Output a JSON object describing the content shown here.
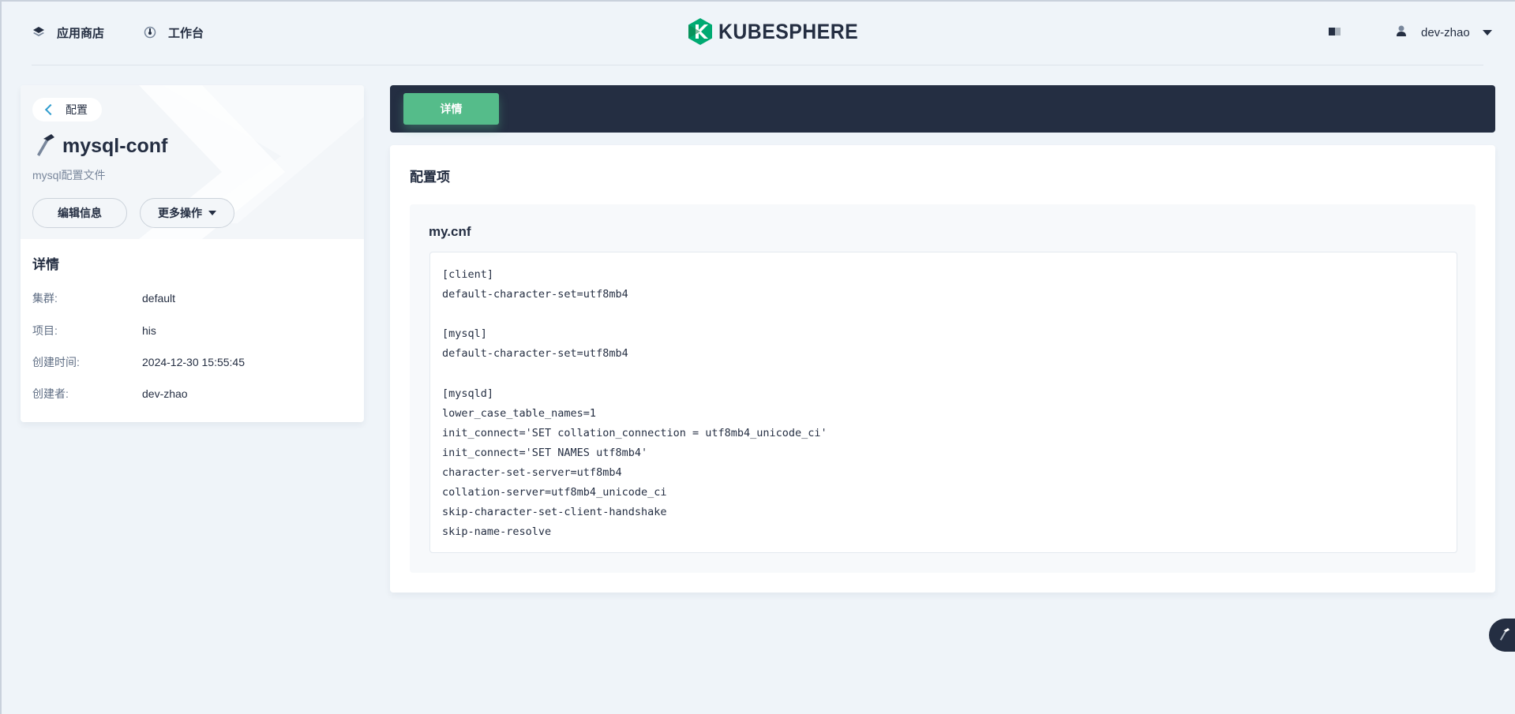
{
  "header": {
    "nav": [
      {
        "label": "应用商店",
        "icon": "layers-icon"
      },
      {
        "label": "工作台",
        "icon": "dashboard-icon"
      }
    ],
    "logo_text": "KUBESPHERE",
    "user": {
      "name": "dev-zhao"
    }
  },
  "resource": {
    "back_label": "配置",
    "name": "mysql-conf",
    "description": "mysql配置文件",
    "buttons": {
      "edit": "编辑信息",
      "more": "更多操作"
    }
  },
  "details": {
    "title": "详情",
    "rows": [
      {
        "key": "集群:",
        "value": "default"
      },
      {
        "key": "项目:",
        "value": "his"
      },
      {
        "key": "创建时间:",
        "value": "2024-12-30 15:55:45"
      },
      {
        "key": "创建者:",
        "value": "dev-zhao"
      }
    ]
  },
  "tabs": [
    {
      "label": "详情",
      "active": true
    }
  ],
  "config": {
    "section_title": "配置项",
    "items": [
      {
        "key": "my.cnf",
        "value": "[client]\ndefault-character-set=utf8mb4\n\n[mysql]\ndefault-character-set=utf8mb4\n\n[mysqld]\nlower_case_table_names=1\ninit_connect='SET collation_connection = utf8mb4_unicode_ci'\ninit_connect='SET NAMES utf8mb4'\ncharacter-set-server=utf8mb4\ncollation-server=utf8mb4_unicode_ci\nskip-character-set-client-handshake\nskip-name-resolve"
      }
    ]
  },
  "colors": {
    "accent_green": "#55bc8a",
    "dark_bar": "#242e42",
    "link_blue": "#329dce",
    "background": "#eff4f9"
  }
}
